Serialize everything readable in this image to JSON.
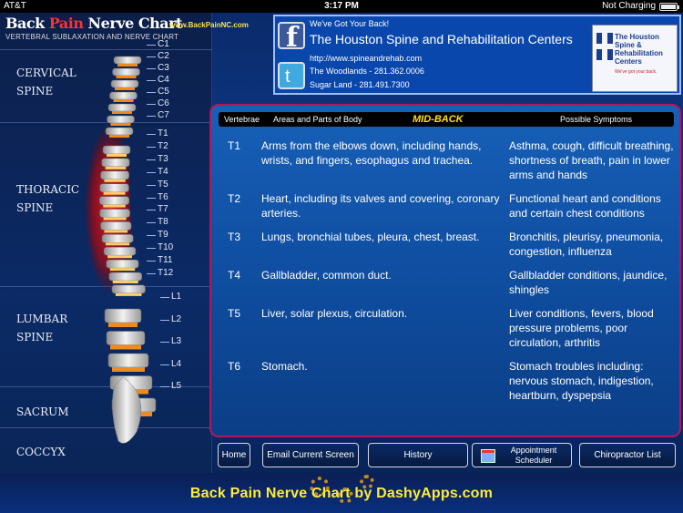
{
  "status_bar": {
    "carrier": "AT&T",
    "time": "3:17 PM",
    "charging": "Not Charging"
  },
  "app": {
    "title_part1": "Back ",
    "title_part2": "Pain",
    "title_part3": " Nerve Chart",
    "subtitle": "VERTEBRAL SUBLAXATION AND NERVE CHART",
    "url": "www.BackPainNC.com"
  },
  "regions": {
    "cervical_1": "CERVICAL",
    "cervical_2": "SPINE",
    "thoracic_1": "THORACIC",
    "thoracic_2": "SPINE",
    "lumbar_1": "LUMBAR",
    "lumbar_2": "SPINE",
    "sacrum": "SACRUM",
    "coccyx": "COCCYX"
  },
  "vertebra_labels": [
    "C1",
    "C2",
    "C3",
    "C4",
    "C5",
    "C6",
    "C7",
    "T1",
    "T2",
    "T3",
    "T4",
    "T5",
    "T6",
    "T7",
    "T8",
    "T9",
    "T10",
    "T11",
    "T12",
    "L1",
    "L2",
    "L3",
    "L4",
    "L5"
  ],
  "sponsor": {
    "tagline": "We've Got Your Back!",
    "org": "The Houston Spine and Rehabilitation Centers",
    "website": "http://www.spineandrehab.com",
    "location1": "The Woodlands - 281.362.0006",
    "location2": "Sugar Land - 281.491.7300",
    "logo_text": "The Houston Spine & Rehabilitation Centers",
    "logo_sub": "We've got your back.",
    "facebook_icon": "f",
    "twitter_icon": "t"
  },
  "table": {
    "col_vertebrae": "Vertebrae",
    "col_areas": "Areas and Parts of Body",
    "section_title": "MID-BACK",
    "col_symptoms": "Possible Symptoms",
    "rows": [
      {
        "v": "T1",
        "areas": "Arms from the elbows down, including hands, wrists, and fingers, esophagus and trachea.",
        "symptoms": "Asthma, cough, difficult breathing, shortness of breath, pain in lower arms and hands"
      },
      {
        "v": "T2",
        "areas": "Heart, including its valves and covering, coronary arteries.",
        "symptoms": "Functional heart and conditions and certain chest conditions"
      },
      {
        "v": "T3",
        "areas": "Lungs, bronchial tubes, pleura, chest, breast.",
        "symptoms": "Bronchitis, pleurisy, pneumonia, congestion, influenza"
      },
      {
        "v": "T4",
        "areas": "Gallbladder, common duct.",
        "symptoms": "Gallbladder conditions, jaundice, shingles"
      },
      {
        "v": "T5",
        "areas": "Liver, solar plexus, circulation.",
        "symptoms": "Liver conditions, fevers, blood pressure problems, poor circulation, arthritis"
      },
      {
        "v": "T6",
        "areas": "Stomach.",
        "symptoms": "Stomach troubles including: nervous stomach, indigestion, heartburn, dyspepsia"
      }
    ]
  },
  "buttons": {
    "home": "Home",
    "email": "Email Current Screen",
    "history": "History",
    "appointment": "Appointment Scheduler",
    "chiropractor": "Chiropractor List"
  },
  "footer": {
    "text": "Back Pain Nerve Chart by DashyApps.com"
  }
}
